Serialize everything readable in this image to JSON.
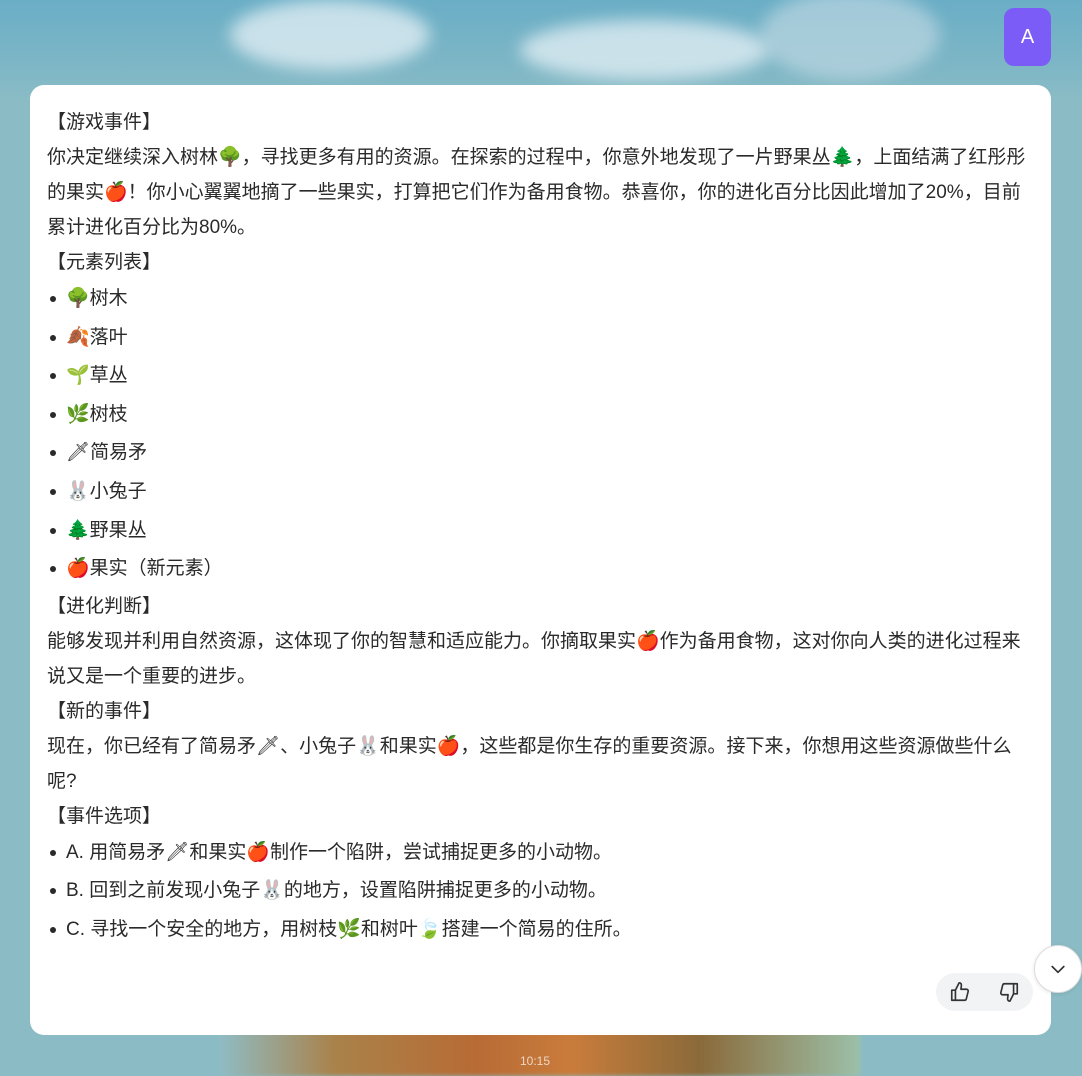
{
  "avatar": {
    "initial": "A",
    "color": "#7b5cf6"
  },
  "message": {
    "event_header": "【游戏事件】",
    "event_text": "你决定继续深入树林🌳，寻找更多有用的资源。在探索的过程中，你意外地发现了一片野果丛🌲，上面结满了红彤彤的果实🍎！你小心翼翼地摘了一些果实，打算把它们作为备用食物。恭喜你，你的进化百分比因此增加了20%，目前累计进化百分比为80%。",
    "elements_header": "【元素列表】",
    "elements": [
      "🌳树木",
      "🍂落叶",
      "🌱草丛",
      "🌿树枝",
      "🗡简易矛",
      "🐰小兔子",
      "🌲野果丛",
      "🍎果实（新元素）"
    ],
    "judgement_header": "【进化判断】",
    "judgement_text": "能够发现并利用自然资源，这体现了你的智慧和适应能力。你摘取果实🍎作为备用食物，这对你向人类的进化过程来说又是一个重要的进步。",
    "new_event_header": "【新的事件】",
    "new_event_text": "现在，你已经有了简易矛🗡、小兔子🐰和果实🍎，这些都是你生存的重要资源。接下来，你想用这些资源做些什么呢?",
    "options_header": "【事件选项】",
    "options": [
      "A. 用简易矛🗡和果实🍎制作一个陷阱，尝试捕捉更多的小动物。",
      "B. 回到之前发现小兔子🐰的地方，设置陷阱捕捉更多的小动物。",
      "C. 寻找一个安全的地方，用树枝🌿和树叶🍃搭建一个简易的住所。"
    ]
  },
  "icons": {
    "like": "thumbs-up-icon",
    "dislike": "thumbs-down-icon",
    "scroll": "chevron-down-icon"
  },
  "bottom_time": "10:15"
}
